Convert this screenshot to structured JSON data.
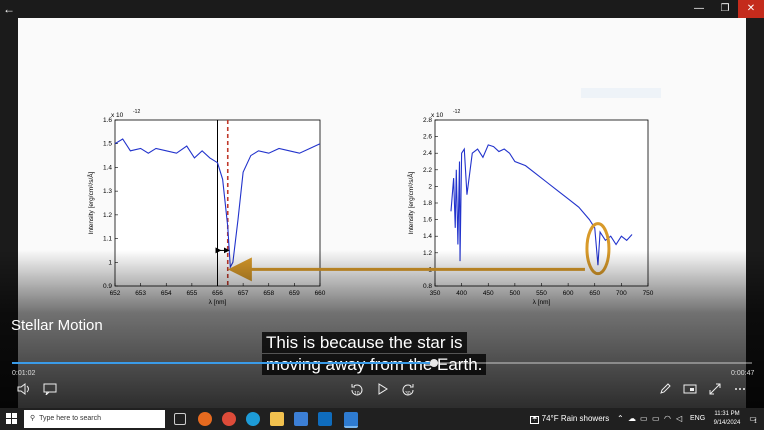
{
  "window": {
    "back_glyph": "←",
    "minimize_glyph": "—",
    "restore_glyph": "❐",
    "close_glyph": "✕"
  },
  "player": {
    "title": "Stellar Motion",
    "caption_line1": "This is because the star is",
    "caption_line2": "moving away from the Earth.",
    "time_elapsed": "0:01:02",
    "time_remaining": "0:00:47",
    "progress": 0.57,
    "accent": "#3a9be8",
    "skip_back_label": "10",
    "skip_fwd_label": "30"
  },
  "left_chart": {
    "exponent": "x 10",
    "exponent_power": "-12",
    "ylabel": "Intensity [erg/cm²/s/Å]",
    "xlabel": "λ [nm]",
    "xticks": [
      "652",
      "653",
      "654",
      "655",
      "656",
      "657",
      "658",
      "659",
      "660"
    ],
    "yticks": [
      "0.9",
      "1",
      "1.1",
      "1.2",
      "1.3",
      "1.4",
      "1.5",
      "1.6"
    ]
  },
  "right_chart": {
    "exponent": "x 10",
    "exponent_power": "-12",
    "ylabel": "Intensity [erg/cm²/s/Å]",
    "xlabel": "λ [nm]",
    "xticks": [
      "350",
      "400",
      "450",
      "500",
      "550",
      "600",
      "650",
      "700",
      "750"
    ],
    "yticks": [
      "0.8",
      "1",
      "1.2",
      "1.4",
      "1.6",
      "1.8",
      "2",
      "2.2",
      "2.4",
      "2.6",
      "2.8"
    ]
  },
  "chart_data": [
    {
      "type": "line",
      "xlabel": "λ [nm]",
      "ylabel": "Intensity [erg/cm²/s/Å]",
      "xlim": [
        652,
        660
      ],
      "ylim": [
        0.9,
        1.6
      ],
      "x": [
        652,
        652.3,
        652.6,
        653,
        653.3,
        653.6,
        654,
        654.4,
        654.8,
        655.1,
        655.4,
        655.7,
        656,
        656.2,
        656.4,
        656.5,
        656.6,
        656.8,
        657,
        657.3,
        657.6,
        658,
        658.4,
        658.8,
        659.2,
        659.6,
        660
      ],
      "y": [
        1.5,
        1.52,
        1.47,
        1.48,
        1.46,
        1.48,
        1.47,
        1.46,
        1.49,
        1.44,
        1.47,
        1.44,
        1.42,
        1.35,
        1.15,
        0.98,
        1.0,
        1.18,
        1.38,
        1.45,
        1.47,
        1.46,
        1.48,
        1.47,
        1.46,
        1.48,
        1.5
      ],
      "reference_lines": [
        {
          "x": 656,
          "color": "#000000"
        },
        {
          "x": 656.4,
          "color": "#c0392b",
          "style": "dashed"
        }
      ]
    },
    {
      "type": "line",
      "xlabel": "λ [nm]",
      "ylabel": "Intensity [erg/cm²/s/Å]",
      "xlim": [
        350,
        750
      ],
      "ylim": [
        0.8,
        2.8
      ],
      "x": [
        380,
        385,
        388,
        390,
        393,
        396,
        397,
        400,
        405,
        410,
        420,
        430,
        440,
        450,
        460,
        470,
        480,
        490,
        500,
        520,
        540,
        560,
        580,
        600,
        620,
        640,
        650,
        656,
        660,
        670,
        680,
        690,
        700,
        710,
        720
      ],
      "y": [
        1.7,
        2.1,
        1.5,
        2.2,
        1.3,
        2.3,
        1.1,
        2.4,
        2.45,
        1.9,
        2.4,
        2.45,
        2.35,
        2.5,
        2.48,
        2.42,
        2.45,
        2.4,
        2.3,
        2.25,
        2.15,
        2.05,
        1.95,
        1.85,
        1.75,
        1.6,
        1.5,
        1.05,
        1.45,
        1.35,
        1.4,
        1.3,
        1.4,
        1.35,
        1.42
      ]
    }
  ],
  "taskbar": {
    "search_placeholder": "Type here to search",
    "weather_temp": "74°F",
    "weather_text": "Rain showers",
    "language": "ENG",
    "clock_time": "11:31 PM",
    "clock_date": "9/14/2024",
    "notif_count": "1"
  }
}
